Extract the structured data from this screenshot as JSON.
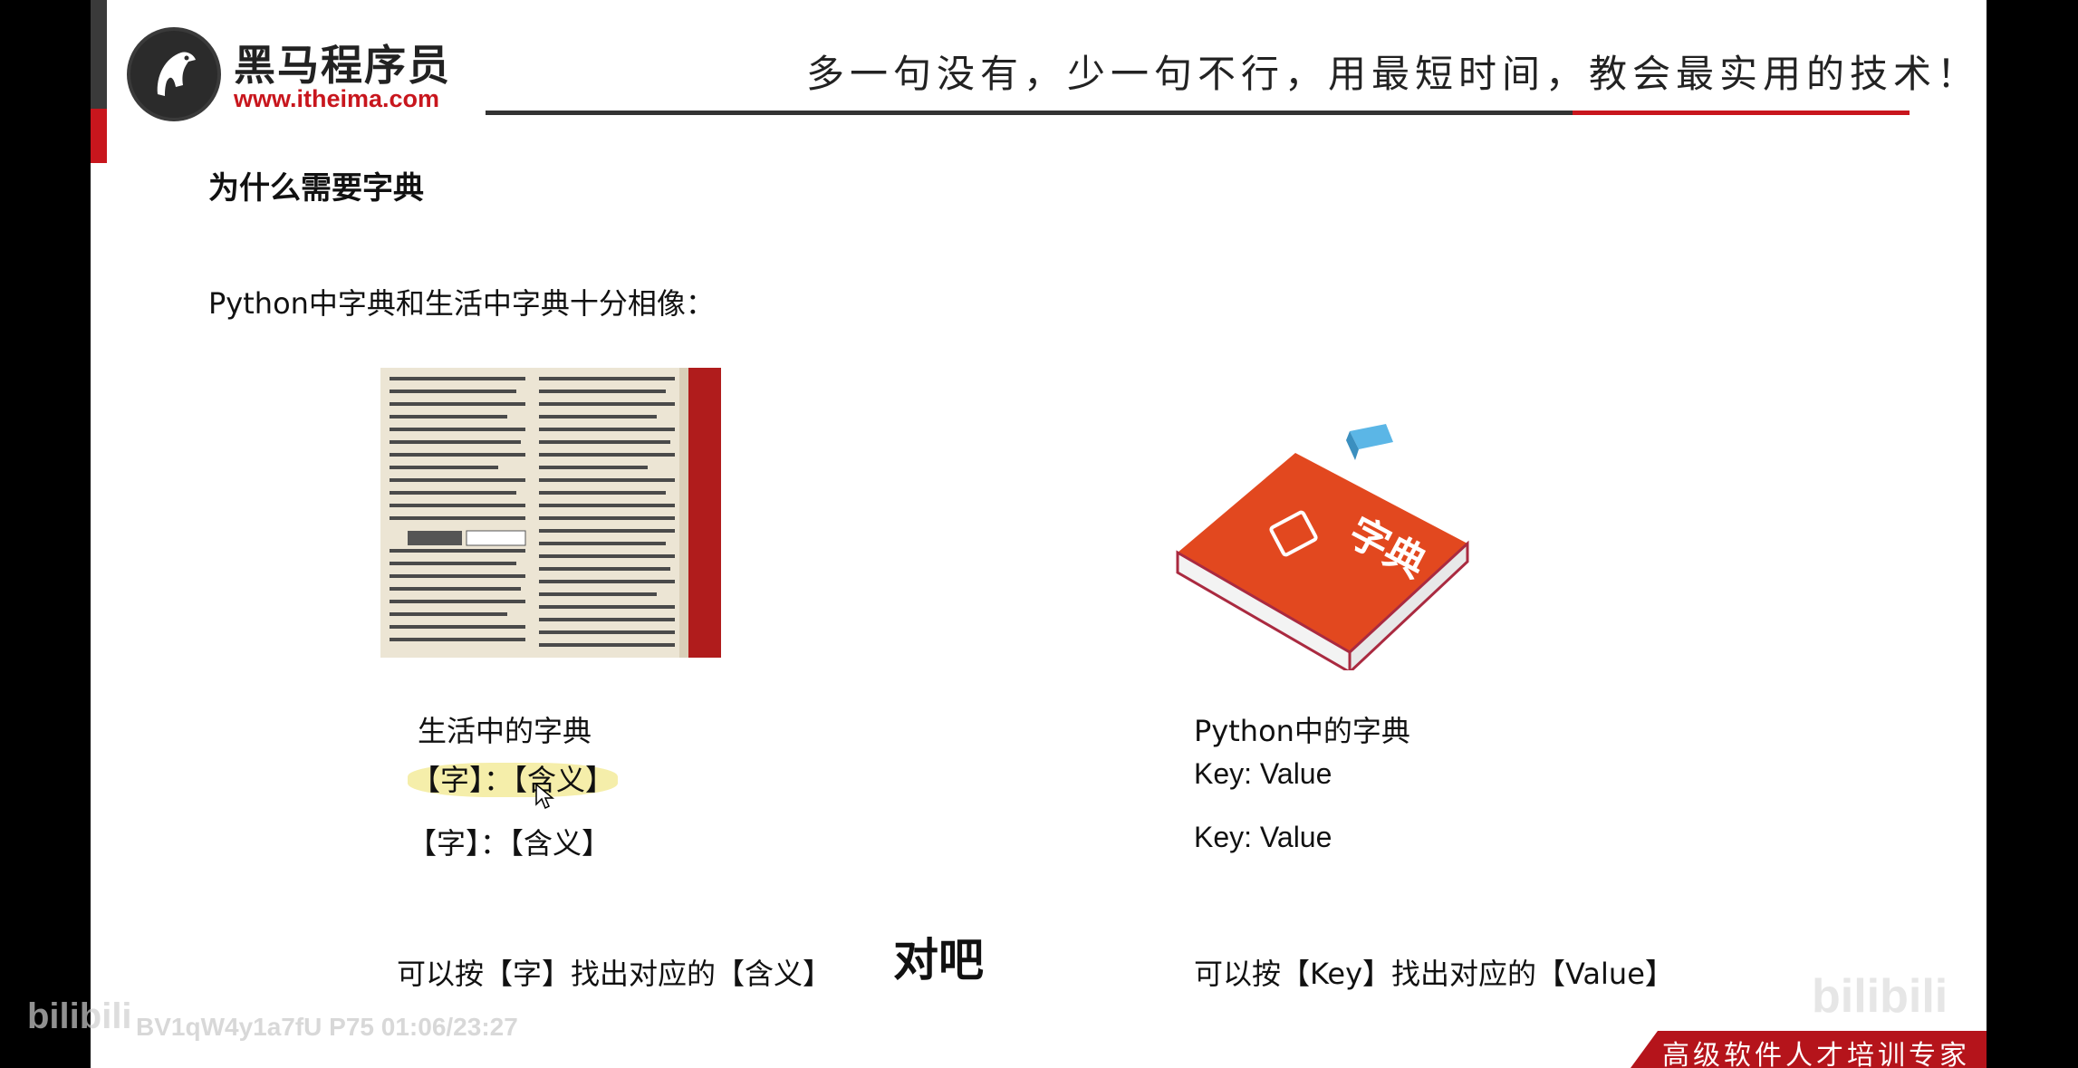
{
  "header": {
    "brand_name": "黑马程序员",
    "brand_url": "www.itheima.com",
    "slogan": "多一句没有，少一句不行，用最短时间，教会最实用的技术！"
  },
  "slide": {
    "heading": "为什么需要字典",
    "intro": "Python中字典和生活中字典十分相像：",
    "book_cover_text": "字典",
    "left_column": {
      "title": "生活中的字典",
      "rows": [
        "【字】：【含义】",
        "【字】：【含义】"
      ],
      "summary": "可以按【字】找出对应的【含义】"
    },
    "right_column": {
      "title": "Python中的字典",
      "rows": [
        "Key: Value",
        "Key: Value"
      ],
      "summary": "可以按【Key】找出对应的【Value】"
    }
  },
  "overlay": {
    "subtitle": "对吧",
    "video_id": "BV1qW4y1a7fU P75 01:06/23:27",
    "watermark": "bilibili"
  },
  "footer": {
    "tagline": "高级软件人才培训专家"
  },
  "colors": {
    "brand_red": "#c8161d",
    "book_orange": "#e2481f",
    "bookmark_blue": "#5bb6e6"
  }
}
